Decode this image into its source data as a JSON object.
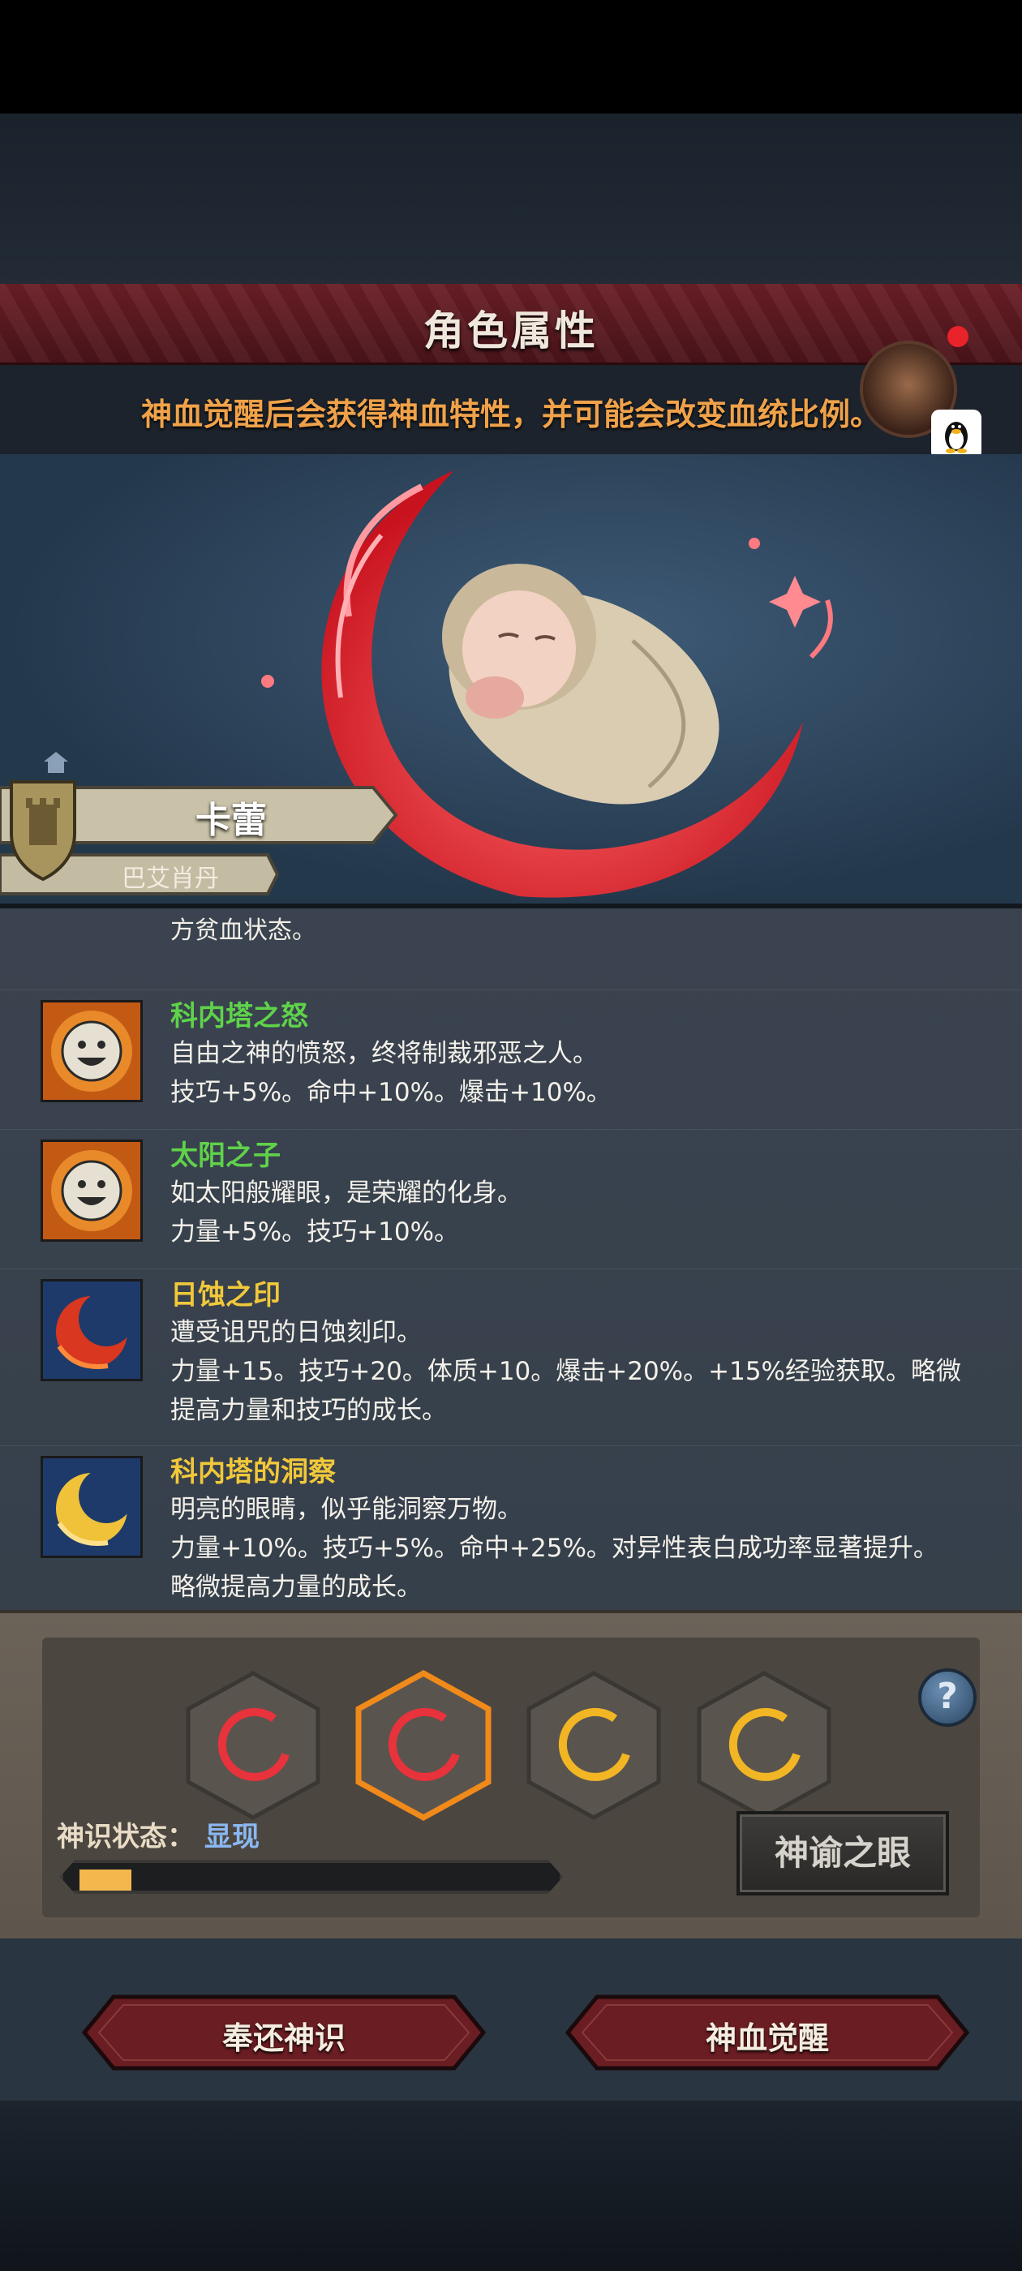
{
  "header": {
    "title": "角色属性",
    "tip": "神血觉醒后会获得神血特性，并可能会改变血统比例。"
  },
  "character": {
    "name": "卡蕾",
    "race": "巴艾肖丹"
  },
  "traits_partial_line": "方贫血状态。",
  "traits": [
    {
      "name": "科内塔之怒",
      "name_color": "#5fd24a",
      "icon": "smile-sun-icon",
      "lines": [
        "自由之神的愤怒，终将制裁邪恶之人。",
        "技巧+5%。命中+10%。爆击+10%。"
      ]
    },
    {
      "name": "太阳之子",
      "name_color": "#5fd24a",
      "icon": "smile-sun-icon",
      "lines": [
        "如太阳般耀眼，是荣耀的化身。",
        "力量+5%。技巧+10%。"
      ]
    },
    {
      "name": "日蚀之印",
      "name_color": "#f1c83a",
      "icon": "red-eclipse-icon",
      "lines": [
        "遭受诅咒的日蚀刻印。",
        "力量+15。技巧+20。体质+10。爆击+20%。+15%经验获取。略微",
        "提高力量和技巧的成长。"
      ]
    },
    {
      "name": "科内塔的洞察",
      "name_color": "#f1c83a",
      "icon": "gold-crescent-icon",
      "lines": [
        "明亮的眼睛，似乎能洞察万物。",
        "力量+10%。技巧+5%。命中+25%。对异性表白成功率显著提升。",
        "略微提高力量的成长。"
      ]
    }
  ],
  "awakening": {
    "slots": [
      {
        "color": "red",
        "selected": false
      },
      {
        "color": "red",
        "selected": true
      },
      {
        "color": "gold",
        "selected": false
      },
      {
        "color": "gold",
        "selected": false
      }
    ],
    "state_label": "神识状态：",
    "state_value": "显现",
    "progress": 0.11,
    "oracle_button": "神谕之眼",
    "help_icon": "?"
  },
  "actions": {
    "return_label": "奉还神识",
    "awaken_label": "神血觉醒"
  }
}
